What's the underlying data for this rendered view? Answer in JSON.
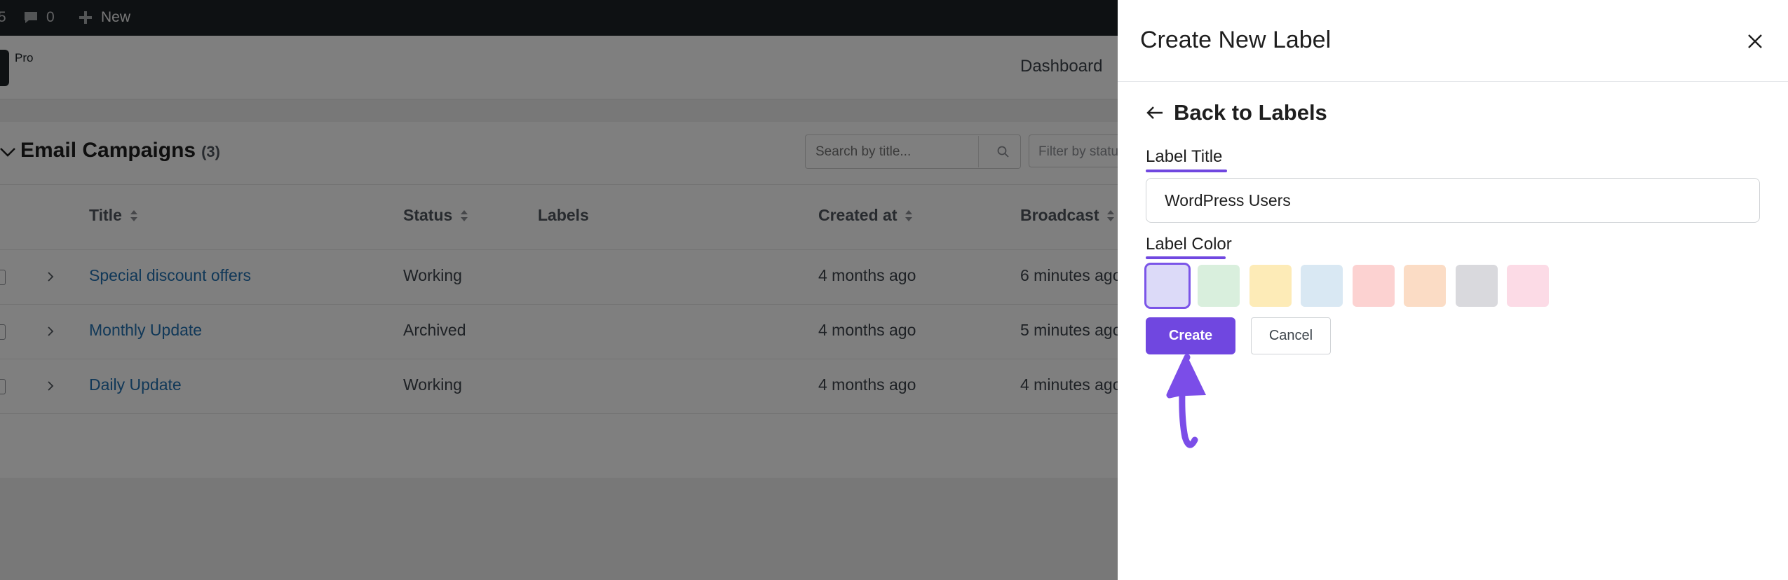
{
  "adminbar": {
    "partial_left": "5",
    "comments_count": "0",
    "new_label": "New"
  },
  "subheader": {
    "logo_label": "Pro",
    "nav_dashboard": "Dashboard"
  },
  "campaigns": {
    "title": "Email Campaigns",
    "count": "(3)",
    "search_placeholder": "Search by title...",
    "filter_placeholder": "Filter by status",
    "columns": {
      "title": "Title",
      "status": "Status",
      "labels": "Labels",
      "created_at": "Created at",
      "broadcast": "Broadcast"
    },
    "rows": [
      {
        "title": "Special discount offers",
        "status": "Working",
        "created": "4 months ago",
        "broadcast": "6 minutes ago"
      },
      {
        "title": "Monthly Update",
        "status": "Archived",
        "created": "4 months ago",
        "broadcast": "5 minutes ago"
      },
      {
        "title": "Daily Update",
        "status": "Working",
        "created": "4 months ago",
        "broadcast": "4 minutes ago"
      }
    ]
  },
  "panel": {
    "title": "Create New Label",
    "back_label": "Back to Labels",
    "label_title_caption": "Label Title",
    "label_title_value": "WordPress Users",
    "label_color_caption": "Label Color",
    "swatches": [
      "#dcdaf8",
      "#d9efdd",
      "#fdebb7",
      "#d9e8f3",
      "#fcd2d1",
      "#fbdcc5",
      "#d9d9dd",
      "#fcdbe6"
    ],
    "selected_swatch": 0,
    "create_label": "Create",
    "cancel_label": "Cancel"
  },
  "colors": {
    "accent": "#7047e0",
    "annotation": "#7b4de8",
    "link": "#2271b1"
  }
}
